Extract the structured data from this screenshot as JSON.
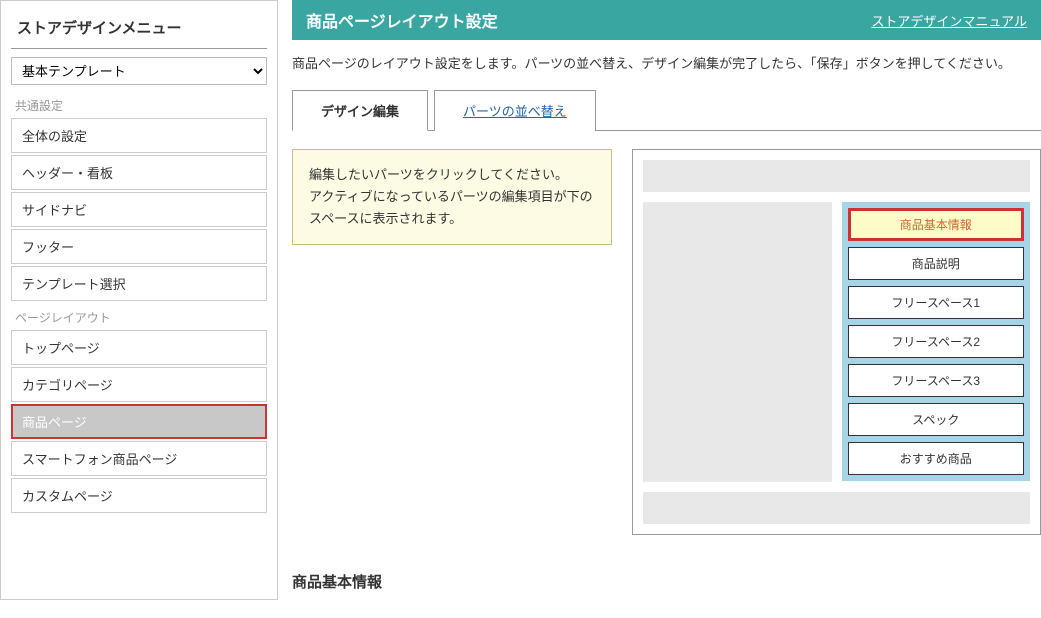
{
  "sidebar": {
    "title": "ストアデザインメニュー",
    "template_select": "基本テンプレート",
    "groups": [
      {
        "label": "共通設定",
        "items": [
          "全体の設定",
          "ヘッダー・看板",
          "サイドナビ",
          "フッター",
          "テンプレート選択"
        ]
      },
      {
        "label": "ページレイアウト",
        "items": [
          "トップページ",
          "カテゴリページ",
          "商品ページ",
          "スマートフォン商品ページ",
          "カスタムページ"
        ]
      }
    ],
    "active_item": "商品ページ"
  },
  "header": {
    "title": "商品ページレイアウト設定",
    "manual_link": "ストアデザインマニュアル"
  },
  "description": "商品ページのレイアウト設定をします。パーツの並べ替え、デザイン編集が完了したら、「保存」ボタンを押してください。",
  "tabs": [
    {
      "label": "デザイン編集",
      "active": true
    },
    {
      "label": "パーツの並べ替え",
      "active": false
    }
  ],
  "instruction": "編集したいパーツをクリックしてください。\nアクティブになっているパーツの編集項目が下のスペースに表示されます。",
  "parts": [
    {
      "label": "商品基本情報",
      "selected": true
    },
    {
      "label": "商品説明",
      "selected": false
    },
    {
      "label": "フリースペース1",
      "selected": false
    },
    {
      "label": "フリースペース2",
      "selected": false
    },
    {
      "label": "フリースペース3",
      "selected": false
    },
    {
      "label": "スペック",
      "selected": false
    },
    {
      "label": "おすすめ商品",
      "selected": false
    }
  ],
  "section_title": "商品基本情報"
}
